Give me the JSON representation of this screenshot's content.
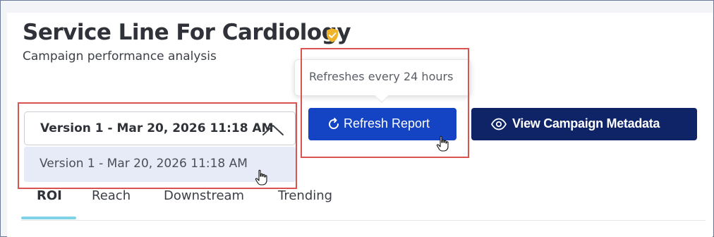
{
  "header": {
    "title": "Service Line For Cardiology",
    "verified_icon": "shield-check-icon",
    "subtitle": "Campaign performance analysis"
  },
  "tooltip": {
    "text": "Refreshes every 24 hours"
  },
  "version_select": {
    "selected": "Version 1 - Mar 20, 2026 11:18 AM",
    "expanded": true,
    "options": [
      "Version 1 - Mar 20, 2026 11:18 AM"
    ]
  },
  "actions": {
    "refresh_label": "Refresh Report",
    "refresh_icon": "refresh-icon",
    "metadata_label": "View Campaign Metadata",
    "metadata_icon": "eye-icon"
  },
  "tabs": [
    {
      "label": "ROI",
      "active": true
    },
    {
      "label": "Reach",
      "active": false
    },
    {
      "label": "Downstream",
      "active": false
    },
    {
      "label": "Trending",
      "active": false
    }
  ],
  "colors": {
    "primary_button": "#1443c3",
    "secondary_button": "#0e2466",
    "highlight": "#d9534f",
    "verified_badge": "#f0b429",
    "tab_indicator": "#7fd3e6"
  }
}
